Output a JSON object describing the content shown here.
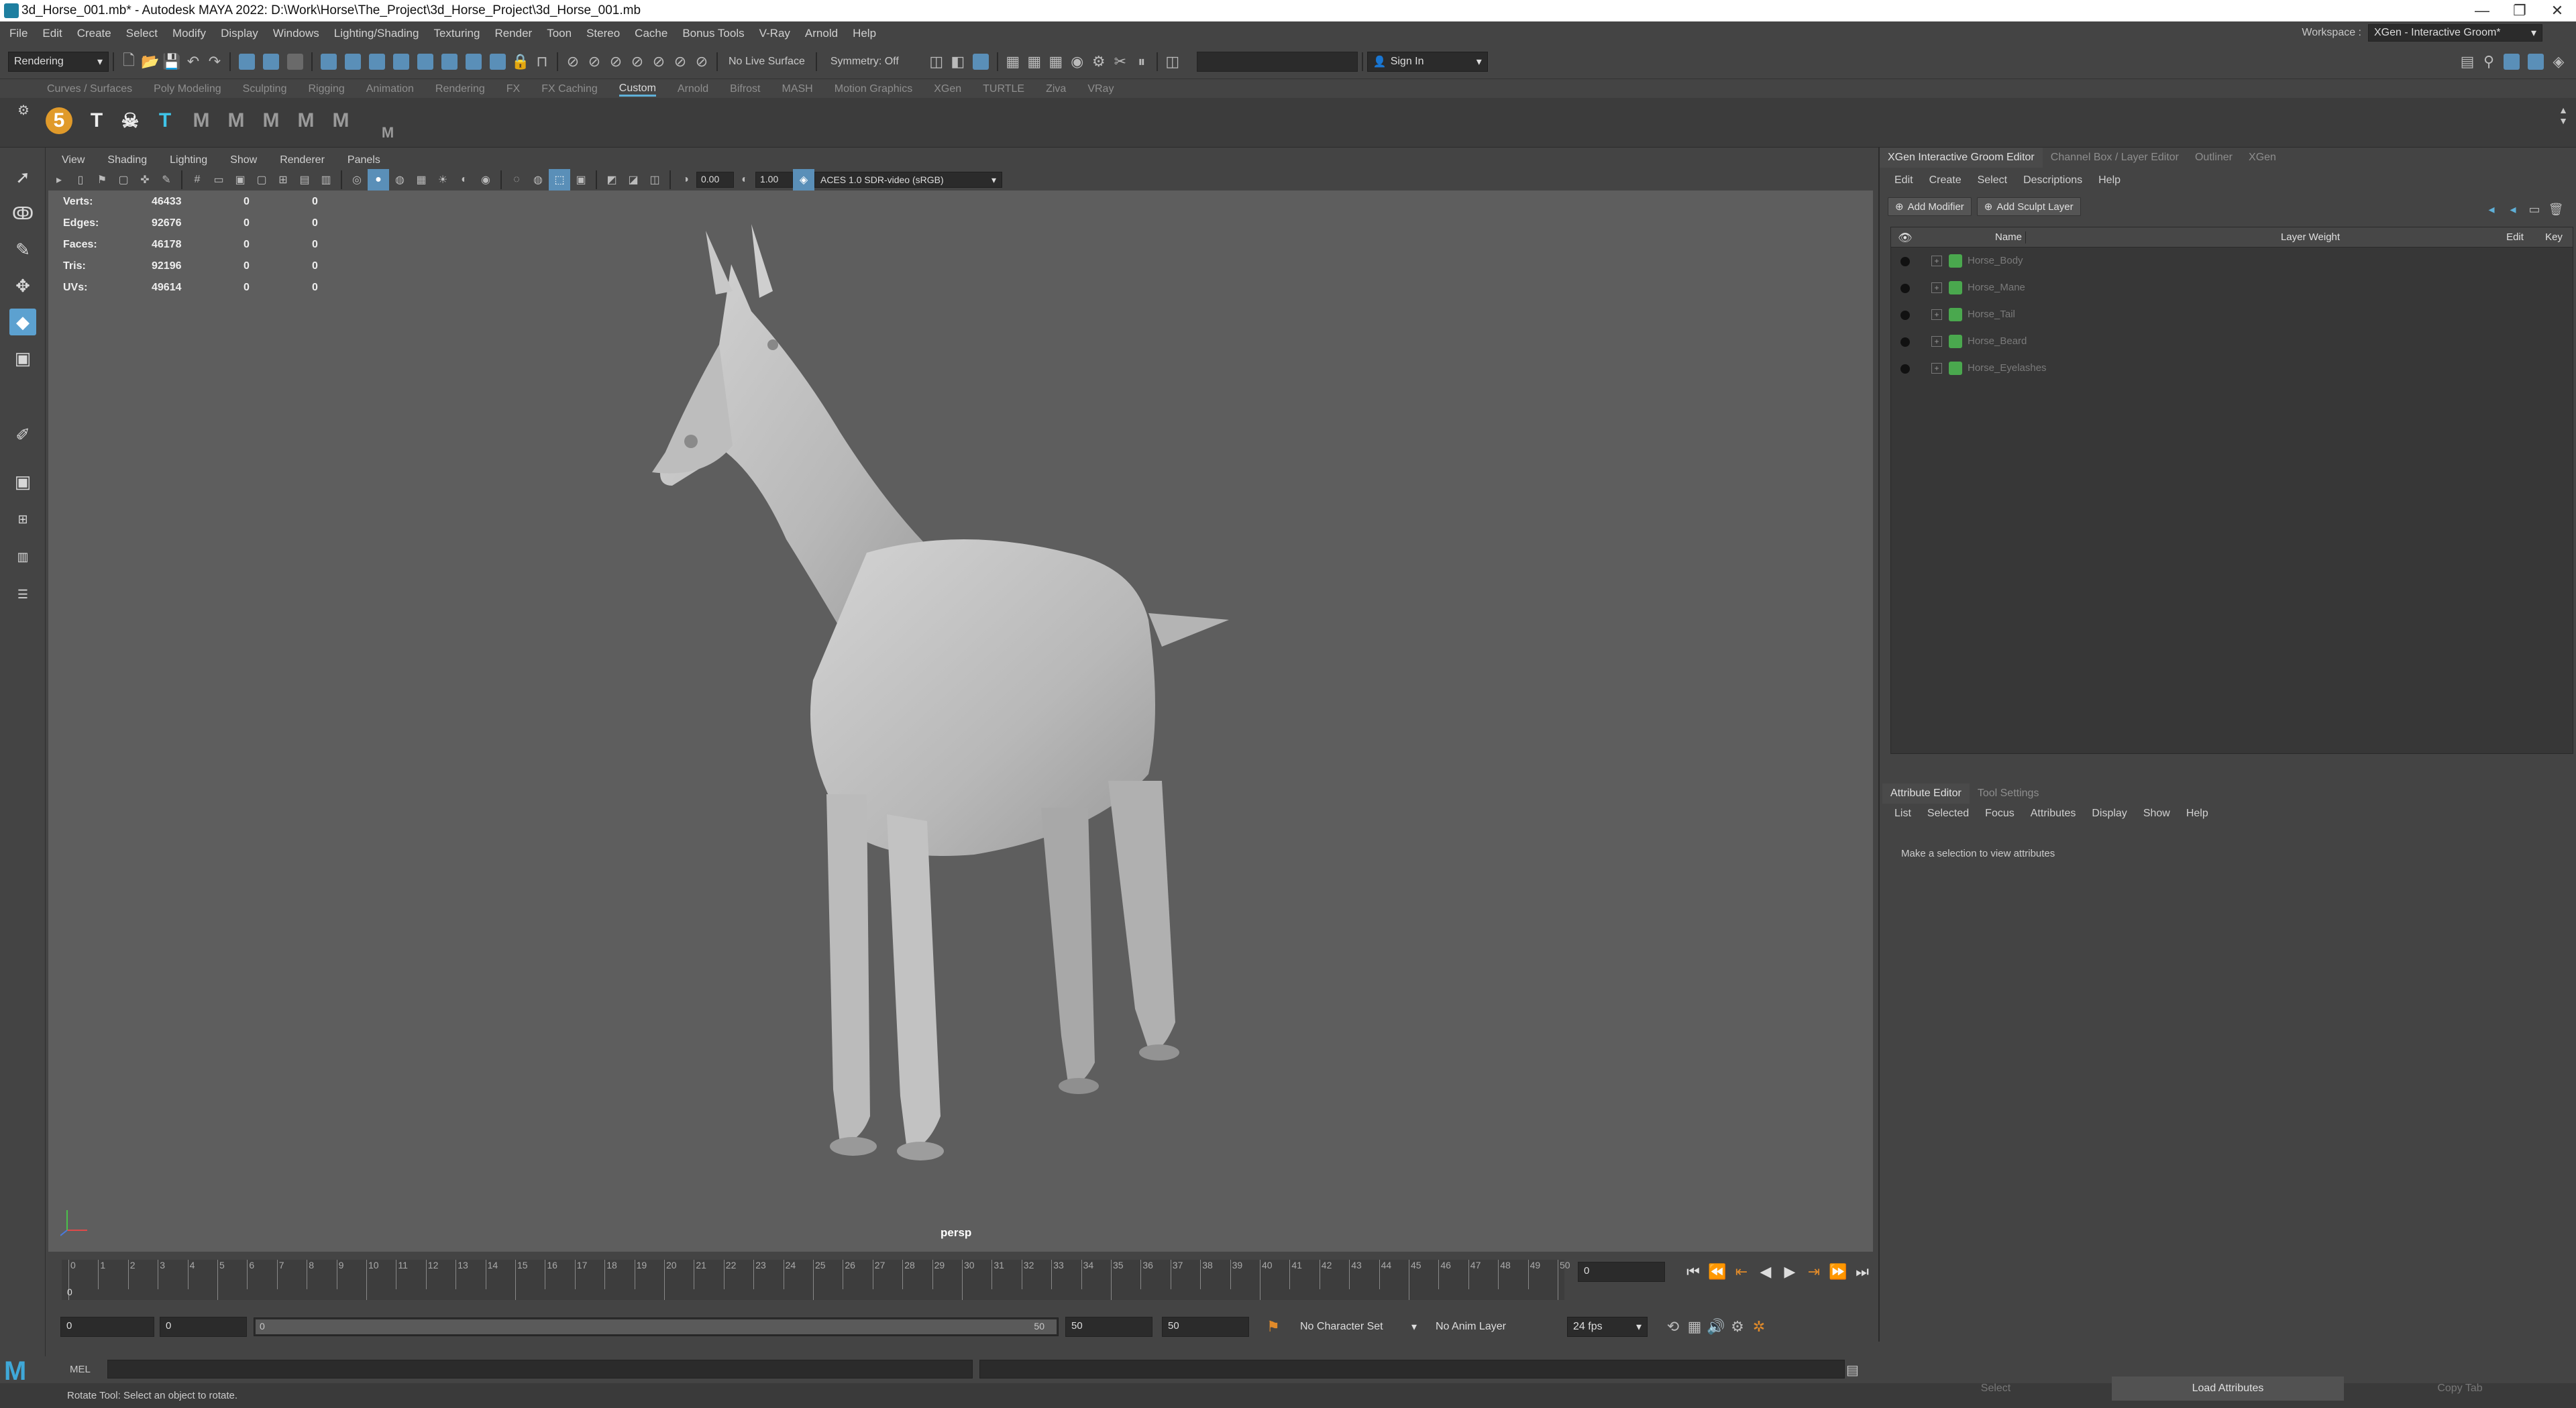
{
  "window": {
    "title": "3d_Horse_001.mb* - Autodesk MAYA 2022: D:\\Work\\Horse\\The_Project\\3d_Horse_Project\\3d_Horse_001.mb",
    "controls": [
      "—",
      "❐",
      "✕"
    ]
  },
  "menubar": {
    "items": [
      "File",
      "Edit",
      "Create",
      "Select",
      "Modify",
      "Display",
      "Windows",
      "Lighting/Shading",
      "Texturing",
      "Render",
      "Toon",
      "Stereo",
      "Cache",
      "Bonus Tools",
      "V-Ray",
      "Arnold",
      "Help"
    ],
    "workspace_label": "Workspace :",
    "workspace_value": "XGen - Interactive Groom*"
  },
  "statusline": {
    "menuset": "Rendering",
    "live_surface": "No Live Surface",
    "symmetry": "Symmetry: Off",
    "sign_in": "Sign In"
  },
  "shelf": {
    "tabs": [
      "Curves / Surfaces",
      "Poly Modeling",
      "Sculpting",
      "Rigging",
      "Animation",
      "Rendering",
      "FX",
      "FX Caching",
      "Custom",
      "Arnold",
      "Bifrost",
      "MASH",
      "Motion Graphics",
      "XGen",
      "TURTLE",
      "Ziva",
      "VRay"
    ],
    "active_tab": "Custom",
    "icons": [
      "5",
      "T",
      "☠",
      "T",
      "M",
      "M",
      "M",
      "M",
      "M",
      "M"
    ]
  },
  "viewport": {
    "menu": [
      "View",
      "Shading",
      "Lighting",
      "Show",
      "Renderer",
      "Panels"
    ],
    "exposure": "0.00",
    "gamma": "1.00",
    "colorspace": "ACES 1.0 SDR-video (sRGB)",
    "camera": "persp",
    "hud": [
      {
        "label": "Verts:",
        "value": "46433",
        "a": "0",
        "b": "0"
      },
      {
        "label": "Edges:",
        "value": "92676",
        "a": "0",
        "b": "0"
      },
      {
        "label": "Faces:",
        "value": "46178",
        "a": "0",
        "b": "0"
      },
      {
        "label": "Tris:",
        "value": "92196",
        "a": "0",
        "b": "0"
      },
      {
        "label": "UVs:",
        "value": "49614",
        "a": "0",
        "b": "0"
      }
    ]
  },
  "timeline": {
    "ticks": [
      "0",
      "1",
      "2",
      "3",
      "4",
      "5",
      "6",
      "7",
      "8",
      "9",
      "10",
      "11",
      "12",
      "13",
      "14",
      "15",
      "16",
      "17",
      "18",
      "19",
      "20",
      "21",
      "22",
      "23",
      "24",
      "25",
      "26",
      "27",
      "28",
      "29",
      "30",
      "31",
      "32",
      "33",
      "34",
      "35",
      "36",
      "37",
      "38",
      "39",
      "40",
      "41",
      "42",
      "43",
      "44",
      "45",
      "46",
      "47",
      "48",
      "49",
      "50"
    ],
    "current_marker": "0",
    "current_frame": "0"
  },
  "range": {
    "start": "0",
    "anim_start": "0",
    "slider_start": "0",
    "slider_end": "50",
    "anim_end": "50",
    "end": "50",
    "character_set": "No Character Set",
    "anim_layer": "No Anim Layer",
    "fps": "24 fps"
  },
  "cmdline": {
    "lang": "MEL",
    "help": "Rotate Tool: Select an object to rotate."
  },
  "rpanel": {
    "tabs": [
      "XGen Interactive Groom Editor",
      "Channel Box / Layer Editor",
      "Outliner",
      "XGen"
    ],
    "menu": [
      "Edit",
      "Create",
      "Select",
      "Descriptions",
      "Help"
    ],
    "add_modifier": "Add Modifier",
    "add_sculpt": "Add Sculpt Layer",
    "columns": {
      "name": "Name",
      "weight": "Layer Weight",
      "edit": "Edit",
      "key": "Key"
    },
    "layers": [
      "Horse_Body",
      "Horse_Mane",
      "Horse_Tail",
      "Horse_Beard",
      "Horse_Eyelashes"
    ],
    "attr_tabs": [
      "Attribute Editor",
      "Tool Settings"
    ],
    "attr_menu": [
      "List",
      "Selected",
      "Focus",
      "Attributes",
      "Display",
      "Show",
      "Help"
    ],
    "attr_message": "Make a selection to view attributes",
    "bottom": [
      "Select",
      "Load Attributes",
      "Copy Tab"
    ]
  }
}
